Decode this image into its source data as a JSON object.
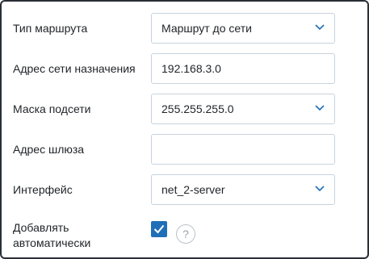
{
  "form": {
    "route_type": {
      "label": "Тип маршрута",
      "value": "Маршрут до сети"
    },
    "dest_network": {
      "label": "Адрес сети назначения",
      "value": "192.168.3.0"
    },
    "subnet_mask": {
      "label": "Маска подсети",
      "value": "255.255.255.0"
    },
    "gateway": {
      "label": "Адрес шлюза",
      "value": ""
    },
    "interface": {
      "label": "Интерфейс",
      "value": "net_2-server"
    },
    "auto_add": {
      "label_line1": "Добавлять",
      "label_line2": "автоматически",
      "checked": true,
      "help_glyph": "?"
    }
  },
  "icons": {
    "dropdown": "chevron-down-icon",
    "checkbox": "checkmark-icon",
    "help": "help-icon"
  },
  "colors": {
    "accent": "#1f6fb8",
    "field_border": "#c7d3dd",
    "chevron": "#1f6fb8"
  }
}
